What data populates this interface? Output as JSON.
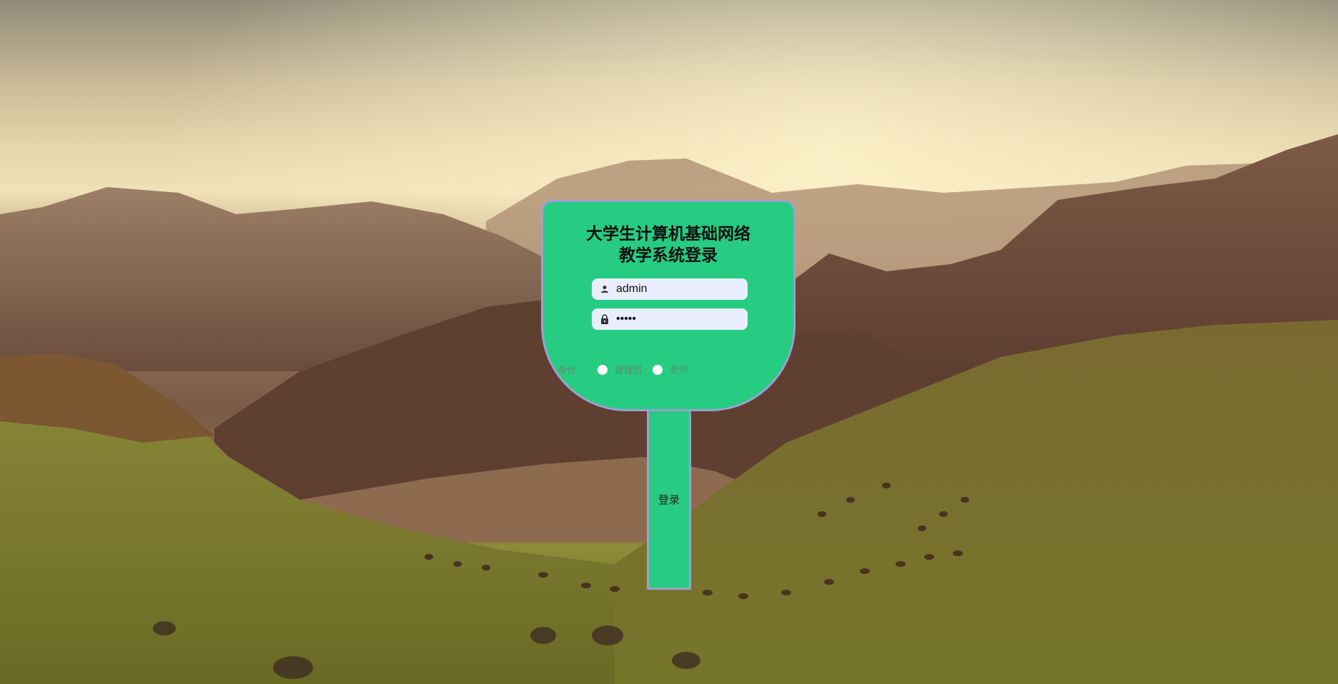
{
  "login": {
    "title_line1": "大学生计算机基础网络",
    "title_line2": "教学系统登录",
    "username": {
      "value": "admin",
      "icon": "user-icon"
    },
    "password": {
      "value": "•••••",
      "icon": "lock-icon"
    },
    "role": {
      "label": "身份",
      "options": [
        "管理员",
        "老师"
      ]
    },
    "submit_label": "登录"
  },
  "colors": {
    "card": "#26cc81",
    "border": "#9aa0d0",
    "input_bg": "#e8eefc"
  }
}
